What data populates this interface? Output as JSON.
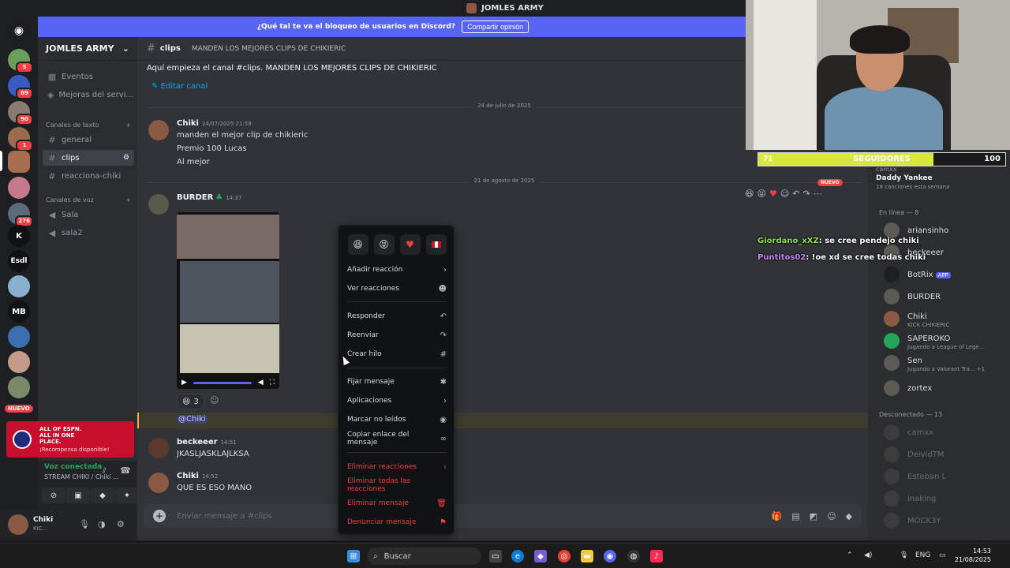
{
  "window": {
    "title": "JOMLES ARMY"
  },
  "banner": {
    "text": "¿Qué tal te va el bloqueo de usuarios en Discord?",
    "button": "Compartir opinión"
  },
  "rail": {
    "badges": [
      "5",
      "69",
      "90",
      "1",
      "276"
    ],
    "letters": [
      "K",
      "Esdl",
      "MB"
    ],
    "new_label": "NUEVO"
  },
  "sidebar": {
    "guild": "JOMLES ARMY",
    "events": "Eventos",
    "boosts": "Mejoras del servi...",
    "text_category": "Canales de texto",
    "voice_category": "Canales de voz",
    "text_channels": [
      "general",
      "clips",
      "reacciona-chiki"
    ],
    "voice_channels": [
      "Sala",
      "sala2"
    ]
  },
  "promo": {
    "line1": "ALL OF ESPN. ALL IN ONE PLACE.",
    "line2": "¡Recompensa disponible!"
  },
  "voice": {
    "status": "Voz conectada",
    "channel": "STREAM CHIKI / Chiki ..."
  },
  "user": {
    "name": "Chiki",
    "status": "KIC..."
  },
  "channel": {
    "name": "clips",
    "topic": "MANDEN LOS MEJORES CLIPS DE CHIKIERIC",
    "intro": "Aquí empieza el canal #clips. MANDEN LOS MEJORES CLIPS DE CHIKIERIC",
    "edit": "Editar canal"
  },
  "messages": {
    "date1": "24 de julio de 2025",
    "m1": {
      "author": "Chiki",
      "time": "24/07/2025 21:59",
      "lines": [
        "manden el mejor clip de chikieric",
        "Premio 100 Lucas",
        "Al mejor"
      ]
    },
    "date2": "21 de agosto de 2025",
    "m2": {
      "author": "BURDER",
      "time": "14:37",
      "reaction_count": "3",
      "mention": "@Chiki",
      "new_tag": "NUEVO"
    },
    "m3": {
      "author": "beckeeer",
      "time": "14:51",
      "text": "JKASLJASKLAJLKSA"
    },
    "m4": {
      "author": "Chiki",
      "time": "14:52",
      "text": "QUE ES ESO MANO"
    }
  },
  "composer": {
    "placeholder": "Enviar mensaje a #clips"
  },
  "context_menu": {
    "items": [
      "Añadir reacción",
      "Ver reacciones",
      "Responder",
      "Reenviar",
      "Crear hilo",
      "Fijar mensaje",
      "Aplicaciones",
      "Marcar no leídos",
      "Copiar enlace del mensaje"
    ],
    "danger_items": [
      "Eliminar reacciones",
      "Eliminar todas las reacciones",
      "Eliminar mensaje",
      "Denunciar mensaje"
    ]
  },
  "stream": {
    "followers_label": "SEGUIDORES",
    "followers_current": "71",
    "followers_goal": "100",
    "followers_fraction": 0.71,
    "chat": [
      {
        "user": "Giordano_xXZ",
        "text": ": se cree pendejo chiki",
        "color": "#8de04b"
      },
      {
        "user": "Puntitos02",
        "text": ": !oe xd se cree todas chiki",
        "color": "#c587f5"
      }
    ]
  },
  "activity": {
    "label": "camxx",
    "title": "Daddy Yankee",
    "sub": "18 canciones esta semana"
  },
  "members": {
    "online_header": "En línea — 8",
    "online": [
      {
        "name": "ariansinho",
        "sub": ""
      },
      {
        "name": "beckeeer",
        "sub": ""
      },
      {
        "name": "BotRix",
        "sub": "",
        "tag": "APP"
      },
      {
        "name": "BURDER",
        "sub": ""
      },
      {
        "name": "Chiki",
        "sub": "KICK CHIKIERIC"
      },
      {
        "name": "SAPEROKO",
        "sub": "Jugando a League of Lege..."
      },
      {
        "name": "Sen",
        "sub": "Jugando a Valorant Tra... +1"
      },
      {
        "name": "zortex",
        "sub": ""
      }
    ],
    "offline_header": "Desconectado — 13",
    "offline": [
      "camxx",
      "DeividTM",
      "Esteban L",
      "inaking",
      "MOCK3Y"
    ]
  },
  "taskbar": {
    "search": "Buscar",
    "lang": "ENG",
    "time": "14:53",
    "date": "21/08/2025"
  }
}
